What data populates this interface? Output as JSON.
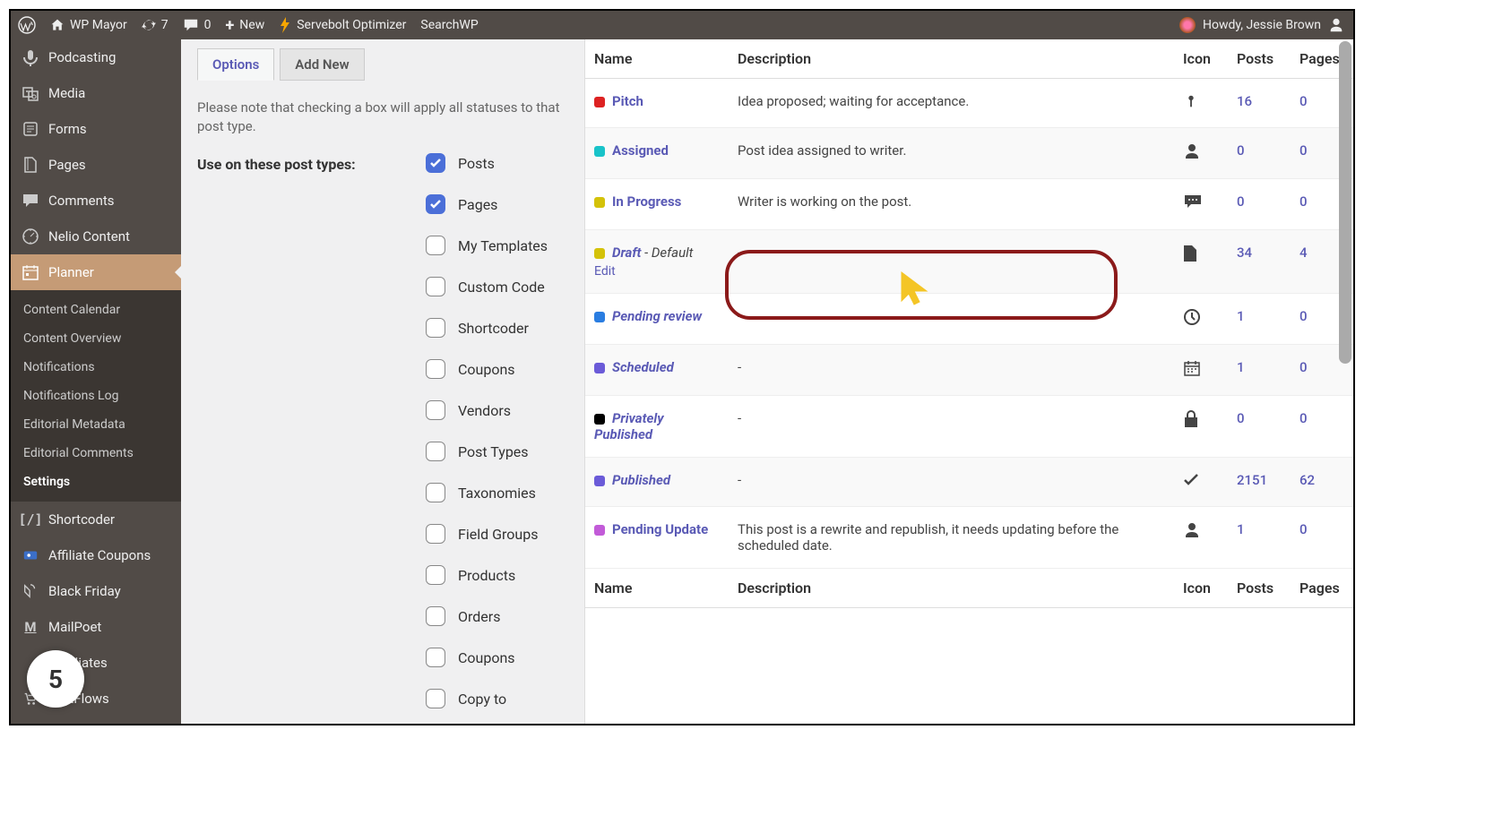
{
  "adminbar": {
    "site": "WP Mayor",
    "updates": "7",
    "comments": "0",
    "new": "New",
    "servebolt": "Servebolt Optimizer",
    "searchwp": "SearchWP",
    "howdy": "Howdy, Jessie Brown"
  },
  "sidebar": {
    "items": [
      {
        "label": "Podcasting"
      },
      {
        "label": "Media"
      },
      {
        "label": "Forms"
      },
      {
        "label": "Pages"
      },
      {
        "label": "Comments"
      },
      {
        "label": "Nelio Content"
      },
      {
        "label": "Planner"
      },
      {
        "label": "Shortcoder"
      },
      {
        "label": "Affiliate Coupons"
      },
      {
        "label": "Black Friday"
      },
      {
        "label": "MailPoet"
      },
      {
        "label": "yAffiliates"
      },
      {
        "label": "CartFlows"
      }
    ],
    "submenu": [
      {
        "label": "Content Calendar"
      },
      {
        "label": "Content Overview"
      },
      {
        "label": "Notifications"
      },
      {
        "label": "Notifications Log"
      },
      {
        "label": "Editorial Metadata"
      },
      {
        "label": "Editorial Comments"
      },
      {
        "label": "Settings"
      }
    ]
  },
  "tabs": {
    "options": "Options",
    "addnew": "Add New"
  },
  "note": "Please note that checking a box will apply all statuses to that post type.",
  "field_label": "Use on these post types:",
  "post_types": [
    {
      "label": "Posts",
      "checked": true
    },
    {
      "label": "Pages",
      "checked": true
    },
    {
      "label": "My Templates",
      "checked": false
    },
    {
      "label": "Custom Code",
      "checked": false
    },
    {
      "label": "Shortcoder",
      "checked": false
    },
    {
      "label": "Coupons",
      "checked": false
    },
    {
      "label": "Vendors",
      "checked": false
    },
    {
      "label": "Post Types",
      "checked": false
    },
    {
      "label": "Taxonomies",
      "checked": false
    },
    {
      "label": "Field Groups",
      "checked": false
    },
    {
      "label": "Products",
      "checked": false
    },
    {
      "label": "Orders",
      "checked": false
    },
    {
      "label": "Coupons",
      "checked": false
    },
    {
      "label": "Copy to",
      "checked": false
    }
  ],
  "table": {
    "headers": {
      "name": "Name",
      "desc": "Description",
      "icon": "Icon",
      "posts": "Posts",
      "pages": "Pages"
    },
    "rows": [
      {
        "color": "#d22",
        "name": "Pitch",
        "italic": false,
        "default": "",
        "edit": "",
        "desc": "Idea proposed; waiting for acceptance.",
        "icon": "pin",
        "posts": "16",
        "pages": "0"
      },
      {
        "color": "#19c3c9",
        "name": "Assigned",
        "italic": false,
        "default": "",
        "edit": "",
        "desc": "Post idea assigned to writer.",
        "icon": "user",
        "posts": "0",
        "pages": "0"
      },
      {
        "color": "#d4c20a",
        "name": "In Progress",
        "italic": false,
        "default": "",
        "edit": "",
        "desc": "Writer is working on the post.",
        "icon": "comment",
        "posts": "0",
        "pages": "0"
      },
      {
        "color": "#d4c20a",
        "name": "Draft",
        "italic": true,
        "default": " - Default",
        "edit": "Edit",
        "desc": "-",
        "icon": "file",
        "posts": "34",
        "pages": "4"
      },
      {
        "color": "#2a7de1",
        "name": "Pending review",
        "italic": true,
        "default": "",
        "edit": "",
        "desc": "-",
        "icon": "clock",
        "posts": "1",
        "pages": "0"
      },
      {
        "color": "#6b5bd8",
        "name": "Scheduled",
        "italic": true,
        "default": "",
        "edit": "",
        "desc": "-",
        "icon": "calendar",
        "posts": "1",
        "pages": "0"
      },
      {
        "color": "#000",
        "name": "Privately Published",
        "italic": true,
        "default": "",
        "edit": "",
        "desc": "-",
        "icon": "lock",
        "posts": "0",
        "pages": "0"
      },
      {
        "color": "#6b5bd8",
        "name": "Published",
        "italic": true,
        "default": "",
        "edit": "",
        "desc": "-",
        "icon": "check",
        "posts": "2151",
        "pages": "62"
      },
      {
        "color": "#c25bd8",
        "name": "Pending Update",
        "italic": false,
        "default": "",
        "edit": "",
        "desc": "This post is a rewrite and republish, it needs updating before the scheduled date.",
        "icon": "user",
        "posts": "1",
        "pages": "0"
      }
    ]
  },
  "badge": "5"
}
